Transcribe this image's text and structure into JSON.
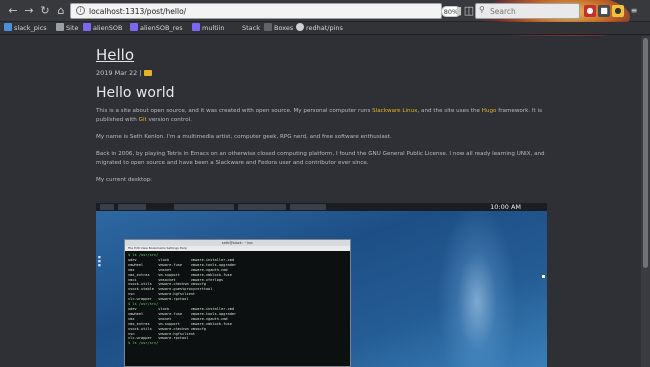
{
  "browser": {
    "url_text": "localhost:1313/post/hello/",
    "zoom_label": "80%",
    "search_placeholder": "Search",
    "bookmarks": [
      {
        "label": "slack_pics",
        "color": "#4a90d9"
      },
      {
        "label": "Site",
        "color": "#9aa0a6"
      },
      {
        "label": "alienSOB",
        "color": "#7b68ee"
      },
      {
        "label": "alienSOB_res",
        "color": "#7b68ee"
      },
      {
        "label": "multiin",
        "color": "#7b68ee"
      },
      {
        "label": "Stack",
        "color": "#333333"
      },
      {
        "label": "Boxes",
        "color": "#5f6368"
      },
      {
        "label": "redhat/pins",
        "color": "#d0d0d0"
      }
    ]
  },
  "post": {
    "title": "Hello",
    "date": "2019 Mar 22",
    "separator": "|",
    "heading": "Hello world",
    "para1_a": "This is a site about open source, and it was created with open source. My personal computer runs ",
    "para1_link1": "Slackware Linux",
    "para1_b": ", and the site uses the ",
    "para1_link2": "Hugo",
    "para1_c": " framework. It is published with ",
    "para1_link3": "Git",
    "para1_d": " version control.",
    "para2": "My name is Seth Kenlon. I'm a multimedia artist, computer geek, RPG nerd, and free software enthusiast.",
    "para3": "Back in 2006, by playing Tetris in Emacs on an otherwise closed computing platform, I found the GNU General Public License. I now all ready learning UNIX, and migrated to open source and have been a Slackware and Fedora user and contributor ever since.",
    "para4": "My current desktop:"
  },
  "desktop": {
    "clock": "10:00 AM",
    "terminal_title": "seth@slack: ~/src",
    "terminal_menu": "File  Edit  View  Bookmarks  Settings  Help",
    "colors": {
      "accent": "#e6b422"
    }
  }
}
